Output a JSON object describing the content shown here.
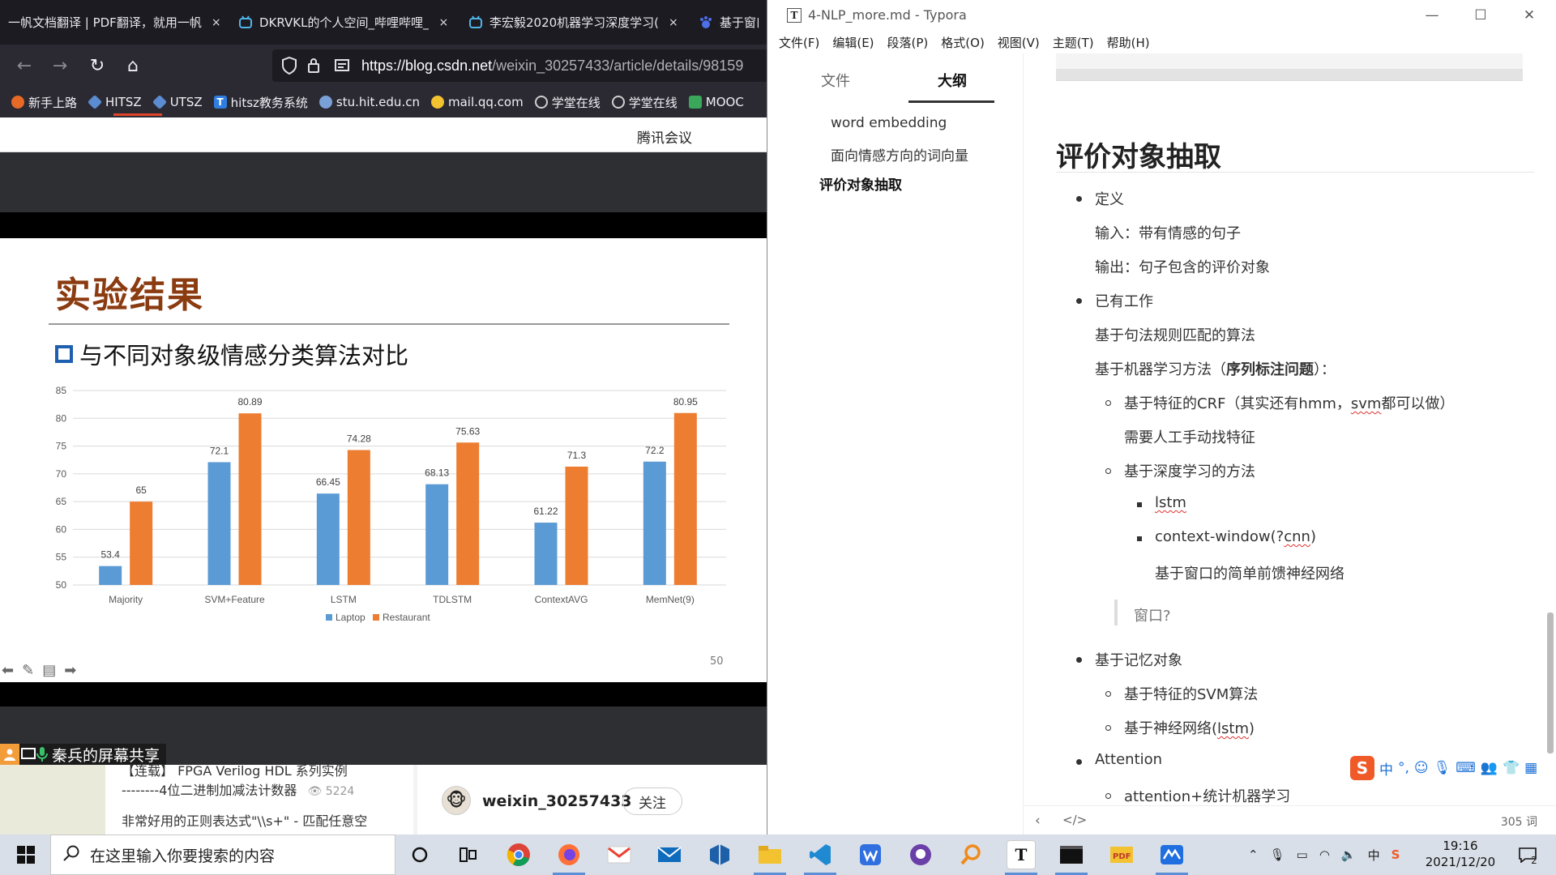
{
  "browser": {
    "tabs": [
      {
        "title": "一帆文档翻译 | PDF翻译，就用一帆",
        "close": "×",
        "icon": "document-icon"
      },
      {
        "title": "DKRVKL的个人空间_哔哩哔哩_",
        "close": "×",
        "icon": "bilibili-icon"
      },
      {
        "title": "李宏毅2020机器学习深度学习(",
        "close": "×",
        "icon": "bilibili-icon"
      },
      {
        "title": "基于窗口",
        "close": "",
        "icon": "baidu-icon"
      }
    ],
    "url_host": "https://blog.csdn.net",
    "url_rest": "/weixin_30257433/article/details/98159",
    "bookmarks": [
      {
        "label": "新手上路",
        "color": "#e66a25"
      },
      {
        "label": "HITSZ",
        "color": "#5b8bd0"
      },
      {
        "label": "UTSZ",
        "color": "#5b8bd0"
      },
      {
        "label": "hitsz教务系统",
        "color": "#2f7de1"
      },
      {
        "label": "stu.hit.edu.cn",
        "color": "#7aa0d8"
      },
      {
        "label": "mail.qq.com",
        "color": "#f2c230"
      },
      {
        "label": "学堂在线",
        "color": "#cfcfcf"
      },
      {
        "label": "学堂在线",
        "color": "#cfcfcf"
      },
      {
        "label": "MOOC",
        "color": "#3aa75a"
      }
    ],
    "meeting_label": "腾讯会议",
    "share_label": "秦兵的屏幕共享",
    "slide": {
      "title": "实验结果",
      "subtitle": "与不同对象级情感分类算法对比",
      "page_number": "50"
    },
    "csdn": {
      "list": [
        {
          "text": "【连载】 FPGA Verilog HDL 系列实例"
        },
        {
          "text": "--------4位二进制加减法计数器",
          "views": "5224"
        },
        {
          "text": "非常好用的正则表达式\"\\\\s+\" - 匹配任意空"
        }
      ],
      "author": "weixin_30257433",
      "follow": "关注"
    }
  },
  "chart_data": {
    "type": "bar",
    "categories": [
      "Majority",
      "SVM+Feature",
      "LSTM",
      "TDLSTM",
      "ContextAVG",
      "MemNet(9)"
    ],
    "series": [
      {
        "name": "Laptop",
        "color": "#5b9bd5",
        "values": [
          53.4,
          72.1,
          66.45,
          68.13,
          61.22,
          72.2
        ]
      },
      {
        "name": "Restaurant",
        "color": "#ed7d31",
        "values": [
          65,
          80.89,
          74.28,
          75.63,
          71.3,
          80.95
        ]
      }
    ],
    "value_labels": [
      [
        "53.4",
        "72.1",
        "66.45",
        "68.13",
        "61.22",
        "72.2"
      ],
      [
        "65",
        "80.89",
        "74.28",
        "75.63",
        "71.3",
        "80.95"
      ]
    ],
    "yticks": [
      "50",
      "55",
      "60",
      "65",
      "70",
      "75",
      "80",
      "85"
    ],
    "ylim": [
      50,
      85
    ],
    "grid": true,
    "legend": "bottom"
  },
  "typora": {
    "title": "4-NLP_more.md - Typora",
    "menu": [
      "文件(F)",
      "编辑(E)",
      "段落(P)",
      "格式(O)",
      "视图(V)",
      "主题(T)",
      "帮助(H)"
    ],
    "side_tabs": [
      "文件",
      "大纲"
    ],
    "outline": [
      "word embedding",
      "面向情感方向的词向量",
      "评价对象抽取"
    ],
    "heading": "评价对象抽取",
    "content": {
      "l1": "定义",
      "l2": "输入：带有情感的句子",
      "l3": "输出：句子包含的评价对象",
      "l4": "已有工作",
      "l5": "基于句法规则匹配的算法",
      "l6a": "基于机器学习方法（",
      "l6b": "序列标注问题",
      "l6c": "）：",
      "l7a": "基于特征的CRF（其实还有hmm，",
      "l7b": "svm",
      "l7c": "都可以做）",
      "l8": "需要人工手动找特征",
      "l9": "基于深度学习的方法",
      "l10": "lstm",
      "l11a": "context-window(?",
      "l11b": "cnn",
      "l11c": ")",
      "l12": "基于窗口的简单前馈神经网络",
      "l13": "窗口?",
      "l14": "基于记忆对象",
      "l15": "基于特征的SVM算法",
      "l16a": "基于神经网络(",
      "l16b": "lstm",
      "l16c": ")",
      "l17": "Attention",
      "l18": "attention+统计机器学习"
    },
    "word_count": "305 词",
    "ime_cn": "中"
  },
  "taskbar": {
    "search_placeholder": "在这里输入你要搜索的内容",
    "time": "19:16",
    "date": "2021/12/20",
    "ime": "中",
    "notif_count": "2"
  }
}
